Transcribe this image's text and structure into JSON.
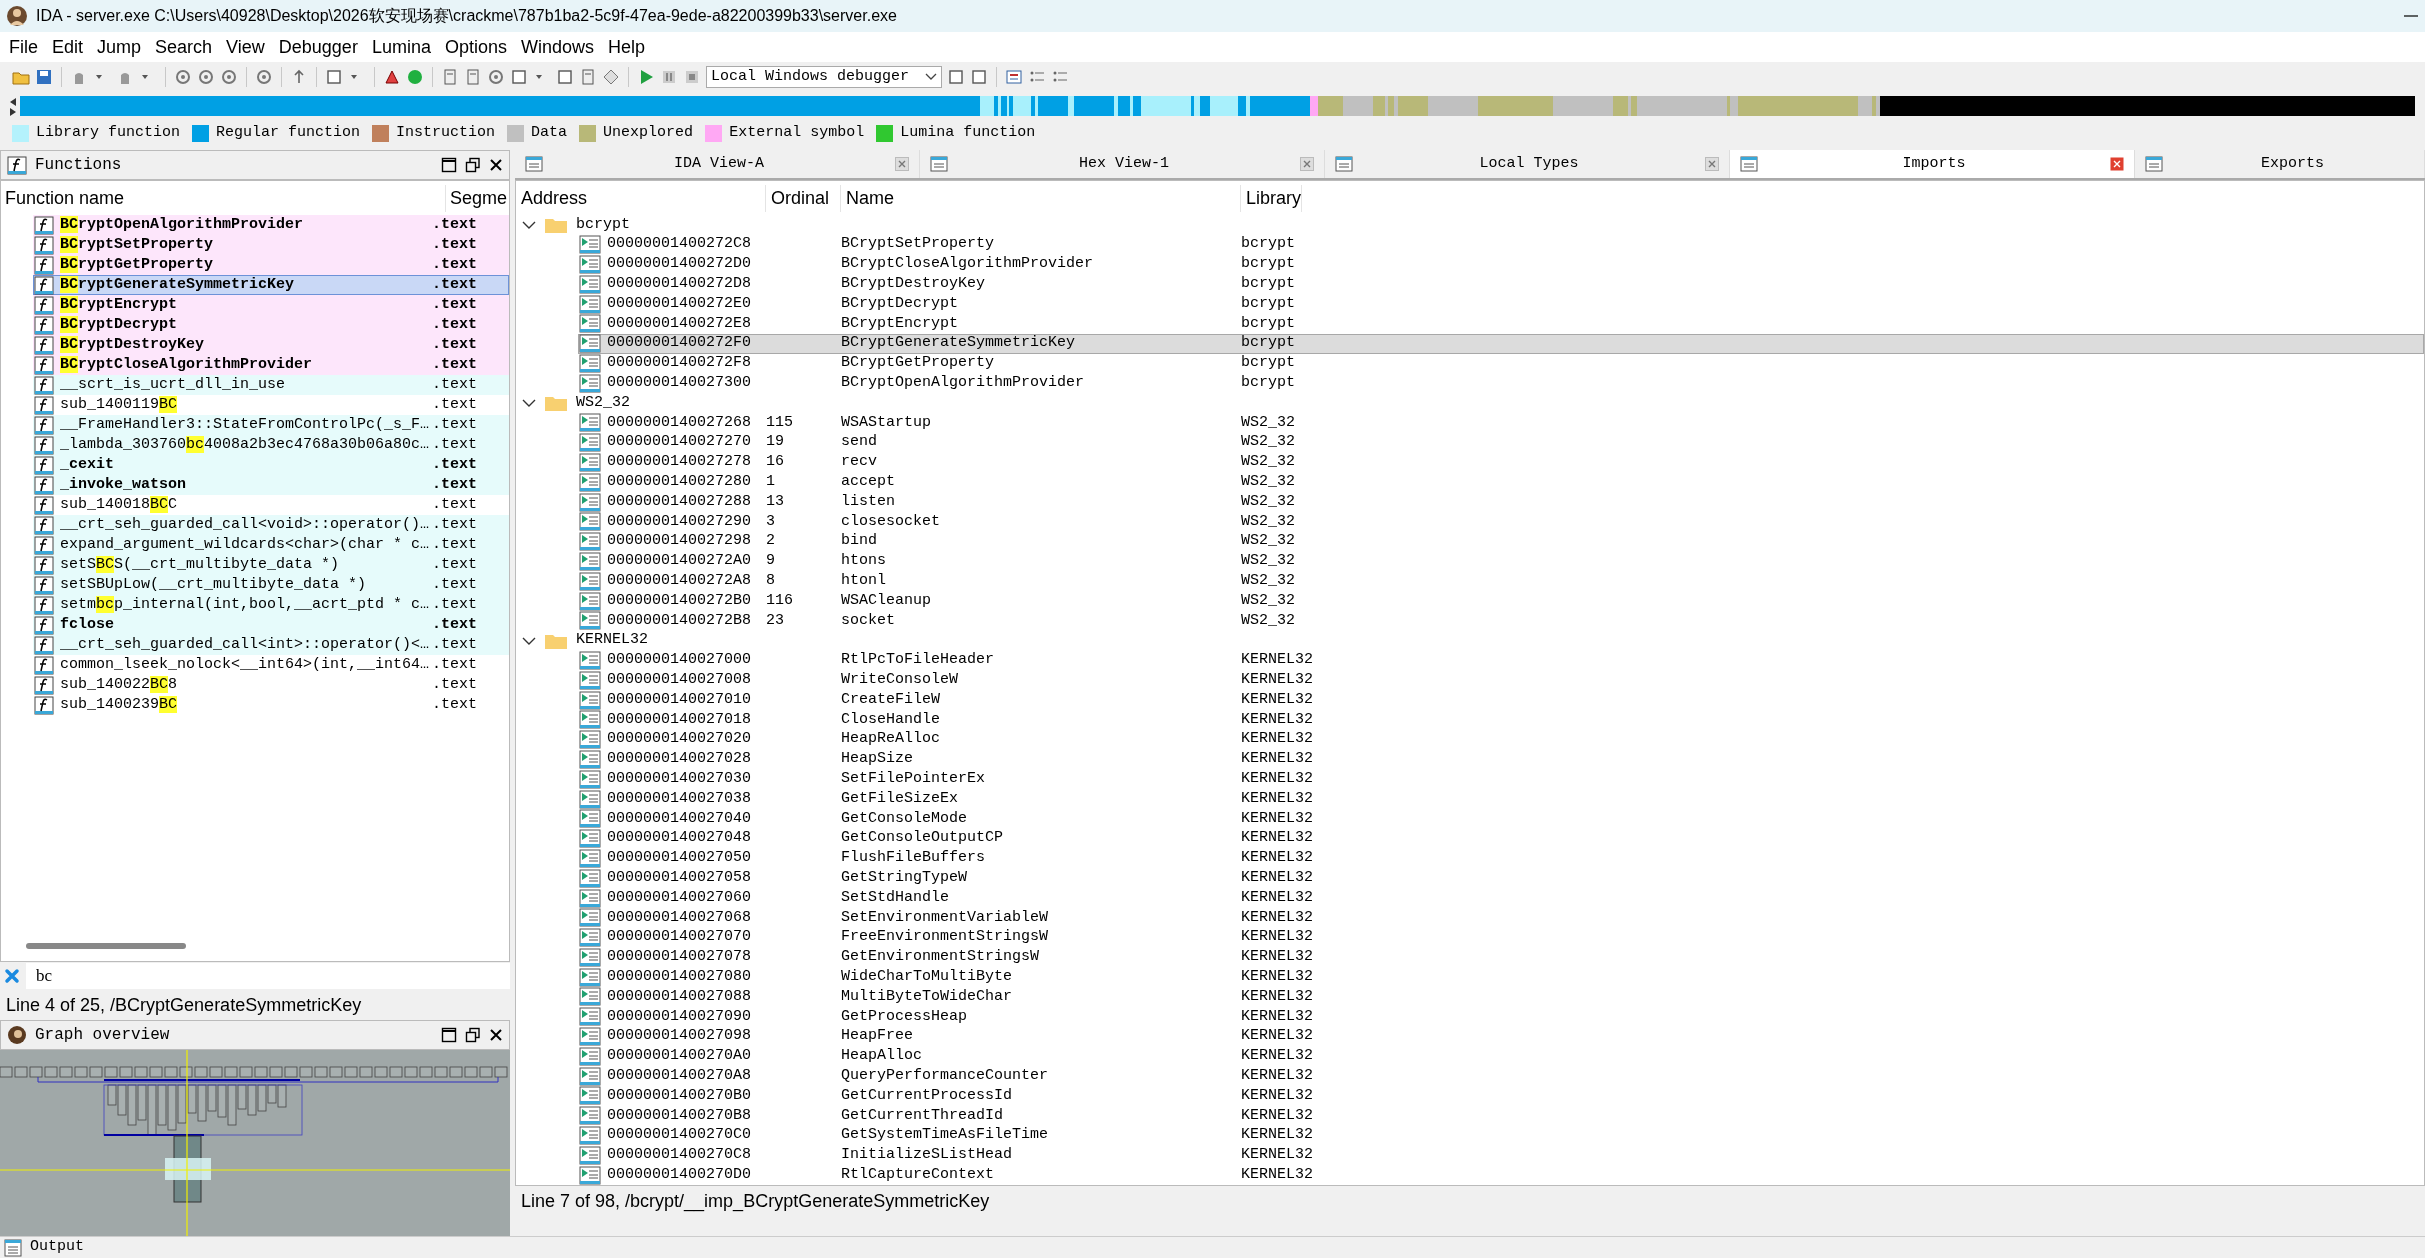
{
  "window": {
    "title": "IDA - server.exe C:\\Users\\40928\\Desktop\\2026软安现场赛\\crackme\\787b1ba2-5c9f-47ea-9ede-a82200399b33\\server.exe"
  },
  "menu": [
    "File",
    "Edit",
    "Jump",
    "Search",
    "View",
    "Debugger",
    "Lumina",
    "Options",
    "Windows",
    "Help"
  ],
  "toolbar": {
    "debugger": "Local Windows debugger"
  },
  "legend": [
    {
      "label": "Library function",
      "color": "#b4f2fc"
    },
    {
      "label": "Regular function",
      "color": "#00a0e4"
    },
    {
      "label": "Instruction",
      "color": "#c0805c"
    },
    {
      "label": "Data",
      "color": "#c0c0c0"
    },
    {
      "label": "Unexplored",
      "color": "#b8b878"
    },
    {
      "label": "External symbol",
      "color": "#ffa8f4"
    },
    {
      "label": "Lumina function",
      "color": "#30c830"
    }
  ],
  "functions_panel": {
    "title": "Functions",
    "columns": [
      "Function name",
      "Segme"
    ],
    "rows": [
      {
        "name": [
          {
            "text": "BC",
            "match": true
          },
          {
            "text": "ryptOpenAlgorithmProvider",
            "match": false
          }
        ],
        "segment": ".text",
        "kind": "external",
        "bold": true,
        "selected": false
      },
      {
        "name": [
          {
            "text": "BC",
            "match": true
          },
          {
            "text": "ryptSetProperty",
            "match": false
          }
        ],
        "segment": ".text",
        "kind": "external",
        "bold": true,
        "selected": false
      },
      {
        "name": [
          {
            "text": "BC",
            "match": true
          },
          {
            "text": "ryptGetProperty",
            "match": false
          }
        ],
        "segment": ".text",
        "kind": "external",
        "bold": true,
        "selected": false
      },
      {
        "name": [
          {
            "text": "BC",
            "match": true
          },
          {
            "text": "ryptGenerateSymmetricKey",
            "match": false
          }
        ],
        "segment": ".text",
        "kind": "external",
        "bold": true,
        "selected": true
      },
      {
        "name": [
          {
            "text": "BC",
            "match": true
          },
          {
            "text": "ryptEncrypt",
            "match": false
          }
        ],
        "segment": ".text",
        "kind": "external",
        "bold": true,
        "selected": false
      },
      {
        "name": [
          {
            "text": "BC",
            "match": true
          },
          {
            "text": "ryptDecrypt",
            "match": false
          }
        ],
        "segment": ".text",
        "kind": "external",
        "bold": true,
        "selected": false
      },
      {
        "name": [
          {
            "text": "BC",
            "match": true
          },
          {
            "text": "ryptDestroyKey",
            "match": false
          }
        ],
        "segment": ".text",
        "kind": "external",
        "bold": true,
        "selected": false
      },
      {
        "name": [
          {
            "text": "BC",
            "match": true
          },
          {
            "text": "ryptCloseAlgorithmProvider",
            "match": false
          }
        ],
        "segment": ".text",
        "kind": "external",
        "bold": true,
        "selected": false
      },
      {
        "name": [
          {
            "text": "__scrt_is_ucrt_dll_in_use",
            "match": false
          }
        ],
        "segment": ".text",
        "kind": "library",
        "bold": false,
        "selected": false
      },
      {
        "name": [
          {
            "text": "sub_1400119",
            "match": false
          },
          {
            "text": "BC",
            "match": true
          }
        ],
        "segment": ".text",
        "kind": "regular",
        "bold": false,
        "selected": false
      },
      {
        "name": [
          {
            "text": "__FrameHandler3::StateFromControlPc(_s_F…",
            "match": false
          }
        ],
        "segment": ".text",
        "kind": "library",
        "bold": false,
        "selected": false
      },
      {
        "name": [
          {
            "text": "_lambda_303760",
            "match": false
          },
          {
            "text": "bc",
            "match": true
          },
          {
            "text": "4008a2b3ec4768a30b06a80c…",
            "match": false
          }
        ],
        "segment": ".text",
        "kind": "library",
        "bold": false,
        "selected": false
      },
      {
        "name": [
          {
            "text": "_cexit",
            "match": false
          }
        ],
        "segment": ".text",
        "kind": "library",
        "bold": true,
        "selected": false
      },
      {
        "name": [
          {
            "text": "_invoke_watson",
            "match": false
          }
        ],
        "segment": ".text",
        "kind": "library",
        "bold": true,
        "selected": false
      },
      {
        "name": [
          {
            "text": "sub_140018",
            "match": false
          },
          {
            "text": "BC",
            "match": true
          },
          {
            "text": "C",
            "match": false
          }
        ],
        "segment": ".text",
        "kind": "regular",
        "bold": false,
        "selected": false
      },
      {
        "name": [
          {
            "text": "__crt_seh_guarded_call<void>::operator()…",
            "match": false
          }
        ],
        "segment": ".text",
        "kind": "library",
        "bold": false,
        "selected": false
      },
      {
        "name": [
          {
            "text": "expand_argument_wildcards<char>(char * c…",
            "match": false
          }
        ],
        "segment": ".text",
        "kind": "library",
        "bold": false,
        "selected": false
      },
      {
        "name": [
          {
            "text": "setS",
            "match": false
          },
          {
            "text": "BC",
            "match": true
          },
          {
            "text": "S(__crt_multibyte_data *)",
            "match": false
          }
        ],
        "segment": ".text",
        "kind": "library",
        "bold": false,
        "selected": false
      },
      {
        "name": [
          {
            "text": "setSBUpLow(__crt_multibyte_data *)",
            "match": false
          }
        ],
        "segment": ".text",
        "kind": "library",
        "bold": false,
        "selected": false
      },
      {
        "name": [
          {
            "text": "setm",
            "match": false
          },
          {
            "text": "bc",
            "match": true
          },
          {
            "text": "p_internal(int,bool,__acrt_ptd * c…",
            "match": false
          }
        ],
        "segment": ".text",
        "kind": "library",
        "bold": false,
        "selected": false
      },
      {
        "name": [
          {
            "text": "fclose",
            "match": false
          }
        ],
        "segment": ".text",
        "kind": "library",
        "bold": true,
        "selected": false
      },
      {
        "name": [
          {
            "text": "__crt_seh_guarded_call<int>::operator()<…",
            "match": false
          }
        ],
        "segment": ".text",
        "kind": "library",
        "bold": false,
        "selected": false
      },
      {
        "name": [
          {
            "text": "common_lseek_nolock<__int64>(int,__int64…",
            "match": false
          }
        ],
        "segment": ".text",
        "kind": "regular",
        "bold": false,
        "selected": false
      },
      {
        "name": [
          {
            "text": "sub_140022",
            "match": false
          },
          {
            "text": "BC",
            "match": true
          },
          {
            "text": "8",
            "match": false
          }
        ],
        "segment": ".text",
        "kind": "regular",
        "bold": false,
        "selected": false
      },
      {
        "name": [
          {
            "text": "sub_1400239",
            "match": false
          },
          {
            "text": "BC",
            "match": true
          }
        ],
        "segment": ".text",
        "kind": "regular",
        "bold": false,
        "selected": false
      }
    ],
    "filter": {
      "value": "bc"
    },
    "status": "Line 4 of 25, /BCryptGenerateSymmetricKey"
  },
  "graph_overview": {
    "title": "Graph overview"
  },
  "tabs": [
    {
      "label": "IDA View-A",
      "selected": false
    },
    {
      "label": "Hex View-1",
      "selected": false
    },
    {
      "label": "Local Types",
      "selected": false
    },
    {
      "label": "Imports",
      "selected": true
    },
    {
      "label": "Exports",
      "selected": false
    }
  ],
  "imports": {
    "columns": [
      "Address",
      "Ordinal",
      "Name",
      "Library"
    ],
    "groups": [
      {
        "label": "bcrypt",
        "expanded": true,
        "children": [
          {
            "address": "00000001400272C8",
            "name": "BCryptSetProperty",
            "library": "bcrypt",
            "selected": false
          },
          {
            "address": "00000001400272D0",
            "name": "BCryptCloseAlgorithmProvider",
            "library": "bcrypt",
            "selected": false
          },
          {
            "address": "00000001400272D8",
            "name": "BCryptDestroyKey",
            "library": "bcrypt",
            "selected": false
          },
          {
            "address": "00000001400272E0",
            "name": "BCryptDecrypt",
            "library": "bcrypt",
            "selected": false
          },
          {
            "address": "00000001400272E8",
            "name": "BCryptEncrypt",
            "library": "bcrypt",
            "selected": false
          },
          {
            "address": "00000001400272F0",
            "name": "BCryptGenerateSymmetricKey",
            "library": "bcrypt",
            "selected": true
          },
          {
            "address": "00000001400272F8",
            "name": "BCryptGetProperty",
            "library": "bcrypt",
            "selected": false
          },
          {
            "address": "0000000140027300",
            "name": "BCryptOpenAlgorithmProvider",
            "library": "bcrypt",
            "selected": false
          }
        ]
      },
      {
        "label": "WS2_32",
        "expanded": true,
        "children": [
          {
            "address": "0000000140027268",
            "ordinal": "115",
            "name": "WSAStartup",
            "library": "WS2_32",
            "selected": false
          },
          {
            "address": "0000000140027270",
            "ordinal": "19",
            "name": "send",
            "library": "WS2_32",
            "selected": false
          },
          {
            "address": "0000000140027278",
            "ordinal": "16",
            "name": "recv",
            "library": "WS2_32",
            "selected": false
          },
          {
            "address": "0000000140027280",
            "ordinal": "1",
            "name": "accept",
            "library": "WS2_32",
            "selected": false
          },
          {
            "address": "0000000140027288",
            "ordinal": "13",
            "name": "listen",
            "library": "WS2_32",
            "selected": false
          },
          {
            "address": "0000000140027290",
            "ordinal": "3",
            "name": "closesocket",
            "library": "WS2_32",
            "selected": false
          },
          {
            "address": "0000000140027298",
            "ordinal": "2",
            "name": "bind",
            "library": "WS2_32",
            "selected": false
          },
          {
            "address": "00000001400272A0",
            "ordinal": "9",
            "name": "htons",
            "library": "WS2_32",
            "selected": false
          },
          {
            "address": "00000001400272A8",
            "ordinal": "8",
            "name": "htonl",
            "library": "WS2_32",
            "selected": false
          },
          {
            "address": "00000001400272B0",
            "ordinal": "116",
            "name": "WSACleanup",
            "library": "WS2_32",
            "selected": false
          },
          {
            "address": "00000001400272B8",
            "ordinal": "23",
            "name": "socket",
            "library": "WS2_32",
            "selected": false
          }
        ]
      },
      {
        "label": "KERNEL32",
        "expanded": true,
        "children": [
          {
            "address": "0000000140027000",
            "name": "RtlPcToFileHeader",
            "library": "KERNEL32",
            "selected": false
          },
          {
            "address": "0000000140027008",
            "name": "WriteConsoleW",
            "library": "KERNEL32",
            "selected": false
          },
          {
            "address": "0000000140027010",
            "name": "CreateFileW",
            "library": "KERNEL32",
            "selected": false
          },
          {
            "address": "0000000140027018",
            "name": "CloseHandle",
            "library": "KERNEL32",
            "selected": false
          },
          {
            "address": "0000000140027020",
            "name": "HeapReAlloc",
            "library": "KERNEL32",
            "selected": false
          },
          {
            "address": "0000000140027028",
            "name": "HeapSize",
            "library": "KERNEL32",
            "selected": false
          },
          {
            "address": "0000000140027030",
            "name": "SetFilePointerEx",
            "library": "KERNEL32",
            "selected": false
          },
          {
            "address": "0000000140027038",
            "name": "GetFileSizeEx",
            "library": "KERNEL32",
            "selected": false
          },
          {
            "address": "0000000140027040",
            "name": "GetConsoleMode",
            "library": "KERNEL32",
            "selected": false
          },
          {
            "address": "0000000140027048",
            "name": "GetConsoleOutputCP",
            "library": "KERNEL32",
            "selected": false
          },
          {
            "address": "0000000140027050",
            "name": "FlushFileBuffers",
            "library": "KERNEL32",
            "selected": false
          },
          {
            "address": "0000000140027058",
            "name": "GetStringTypeW",
            "library": "KERNEL32",
            "selected": false
          },
          {
            "address": "0000000140027060",
            "name": "SetStdHandle",
            "library": "KERNEL32",
            "selected": false
          },
          {
            "address": "0000000140027068",
            "name": "SetEnvironmentVariableW",
            "library": "KERNEL32",
            "selected": false
          },
          {
            "address": "0000000140027070",
            "name": "FreeEnvironmentStringsW",
            "library": "KERNEL32",
            "selected": false
          },
          {
            "address": "0000000140027078",
            "name": "GetEnvironmentStringsW",
            "library": "KERNEL32",
            "selected": false
          },
          {
            "address": "0000000140027080",
            "name": "WideCharToMultiByte",
            "library": "KERNEL32",
            "selected": false
          },
          {
            "address": "0000000140027088",
            "name": "MultiByteToWideChar",
            "library": "KERNEL32",
            "selected": false
          },
          {
            "address": "0000000140027090",
            "name": "GetProcessHeap",
            "library": "KERNEL32",
            "selected": false
          },
          {
            "address": "0000000140027098",
            "name": "HeapFree",
            "library": "KERNEL32",
            "selected": false
          },
          {
            "address": "00000001400270A0",
            "name": "HeapAlloc",
            "library": "KERNEL32",
            "selected": false
          },
          {
            "address": "00000001400270A8",
            "name": "QueryPerformanceCounter",
            "library": "KERNEL32",
            "selected": false
          },
          {
            "address": "00000001400270B0",
            "name": "GetCurrentProcessId",
            "library": "KERNEL32",
            "selected": false
          },
          {
            "address": "00000001400270B8",
            "name": "GetCurrentThreadId",
            "library": "KERNEL32",
            "selected": false
          },
          {
            "address": "00000001400270C0",
            "name": "GetSystemTimeAsFileTime",
            "library": "KERNEL32",
            "selected": false
          },
          {
            "address": "00000001400270C8",
            "name": "InitializeSListHead",
            "library": "KERNEL32",
            "selected": false
          },
          {
            "address": "00000001400270D0",
            "name": "RtlCaptureContext",
            "library": "KERNEL32",
            "selected": false
          }
        ]
      }
    ],
    "status": "Line 7 of 98, /bcrypt/__imp_BCryptGenerateSymmetricKey"
  },
  "output": {
    "title": "Output"
  }
}
